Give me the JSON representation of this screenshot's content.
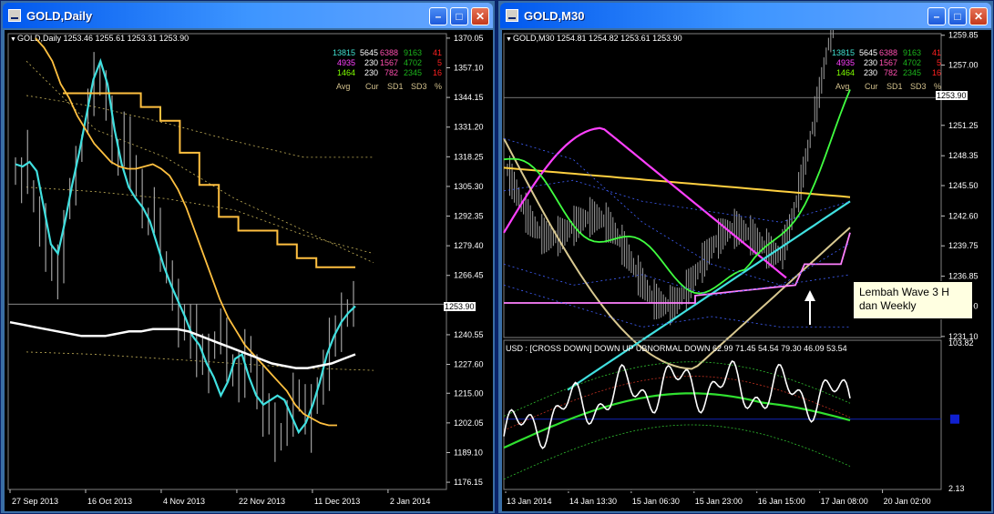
{
  "windows": [
    {
      "title": "GOLD,Daily",
      "header": "GOLD,Daily  1253.46 1255.61 1253.31 1253.90",
      "current_price_label": "1253.90"
    },
    {
      "title": "GOLD,M30",
      "header": "GOLD,M30  1254.81 1254.82 1253.61 1253.90",
      "current_price_label": "1253.90",
      "annotation": [
        "Lembah Wave 3 H",
        "dan Weekly"
      ],
      "indicator_header": "USD :  [CROSS DOWN]   DOWN    UP   UBNORMAL DOWN     62.99 71.45 54.54 79.30  46.09 53.54"
    }
  ],
  "stats_table": {
    "rows": [
      {
        "avg": "13815",
        "cur": "5645",
        "sd1": "6388",
        "sd3": "9163",
        "pct": "41",
        "avg_color": "#40e0d0",
        "sd1_color": "#ff4fb0",
        "sd3_color": "#1cb51c",
        "pct_color": "#ff2020"
      },
      {
        "avg": "4935",
        "cur": "230",
        "sd1": "1567",
        "sd3": "4702",
        "pct": "5",
        "avg_color": "#ff40ff",
        "sd1_color": "#ff4fb0",
        "sd3_color": "#1cb51c",
        "pct_color": "#ff2020"
      },
      {
        "avg": "1464",
        "cur": "230",
        "sd1": "782",
        "sd3": "2345",
        "pct": "16",
        "avg_color": "#7fff00",
        "sd1_color": "#ff4fb0",
        "sd3_color": "#1cb51c",
        "pct_color": "#ff2020"
      }
    ],
    "headers": [
      "Avg",
      "Cur",
      "SD1",
      "SD3",
      "%"
    ],
    "header_color": "#d2c08c",
    "cur_color": "#ffffff"
  },
  "chart_data": [
    {
      "type": "line",
      "name": "GOLD,Daily",
      "ohlc": {
        "open": 1253.46,
        "high": 1255.61,
        "low": 1253.31,
        "close": 1253.9
      },
      "x_ticks": [
        "27 Sep 2013",
        "16 Oct 2013",
        "4 Nov 2013",
        "22 Nov 2013",
        "11 Dec 2013",
        "2 Jan 2014"
      ],
      "y_ticks": [
        1370.05,
        1357.1,
        1344.15,
        1331.2,
        1318.25,
        1305.3,
        1292.35,
        1279.4,
        1266.45,
        1253.9,
        1240.55,
        1227.6,
        1215.0,
        1202.05,
        1189.1,
        1176.15
      ],
      "ylim": [
        1173,
        1372
      ],
      "series": [
        {
          "color": "#a0a0a0",
          "style": "bars",
          "values": [
            1312,
            1308,
            1316,
            1301,
            1290,
            1283,
            1272,
            1268,
            1279,
            1300,
            1310,
            1322,
            1338,
            1350,
            1352,
            1345,
            1330,
            1318,
            1326,
            1320,
            1310,
            1300,
            1290,
            1295,
            1282,
            1270,
            1262,
            1250,
            1246,
            1242,
            1238,
            1232,
            1228,
            1236,
            1242,
            1234,
            1225,
            1222,
            1228,
            1232,
            1220,
            1212,
            1206,
            1198,
            1196,
            1202,
            1210,
            1214,
            1208,
            1204,
            1214,
            1222,
            1232,
            1240,
            1246,
            1250,
            1254
          ]
        },
        {
          "color": "#40e0e0",
          "values": [
            1315,
            1314,
            1316,
            1312,
            1296,
            1280,
            1276,
            1290,
            1306,
            1320,
            1336,
            1352,
            1360,
            1350,
            1330,
            1315,
            1305,
            1300,
            1296,
            1290,
            1280,
            1270,
            1262,
            1255,
            1248,
            1240,
            1236,
            1228,
            1222,
            1214,
            1220,
            1230,
            1232,
            1222,
            1214,
            1210,
            1212,
            1214,
            1212,
            1205,
            1198,
            1202,
            1210,
            1220,
            1232,
            1240,
            1246,
            1250,
            1253
          ]
        },
        {
          "color": "#ffc040",
          "values": [
            1370,
            1366,
            1360,
            1350,
            1344,
            1336,
            1330,
            1324,
            1320,
            1316,
            1314,
            1313,
            1313,
            1314,
            1315,
            1313,
            1310,
            1304,
            1296,
            1286,
            1276,
            1266,
            1256,
            1248,
            1242,
            1236,
            1232,
            1228,
            1224,
            1220,
            1216,
            1210,
            1206,
            1204,
            1202,
            1201,
            1201
          ]
        },
        {
          "color": "#ffffff",
          "values": [
            1246,
            1245,
            1244,
            1243,
            1242,
            1241,
            1240,
            1240,
            1240,
            1241,
            1242,
            1242,
            1243,
            1243,
            1243,
            1242,
            1240,
            1238,
            1236,
            1234,
            1232,
            1230,
            1228,
            1227,
            1226,
            1226,
            1227,
            1228,
            1230,
            1232
          ]
        },
        {
          "color": "#ffc040",
          "style": "step",
          "values": [
            1346,
            1346,
            1346,
            1346,
            1340,
            1334,
            1320,
            1306,
            1292,
            1286,
            1286,
            1280,
            1274,
            1270,
            1270,
            1270
          ]
        }
      ]
    },
    {
      "type": "line",
      "name": "GOLD,M30",
      "ohlc": {
        "open": 1254.81,
        "high": 1254.82,
        "low": 1253.61,
        "close": 1253.9
      },
      "x_ticks": [
        "13 Jan 2014",
        "14 Jan 13:30",
        "15 Jan 06:30",
        "15 Jan 23:00",
        "16 Jan 15:00",
        "17 Jan 08:00",
        "20 Jan 02:00"
      ],
      "y_ticks": [
        1259.85,
        1257.0,
        1253.9,
        1251.25,
        1248.35,
        1245.5,
        1242.6,
        1239.75,
        1236.85,
        1234.0,
        1231.1
      ],
      "ylim": [
        1231,
        1260
      ],
      "indicator_ylim": [
        2.13,
        103.82
      ],
      "indicator_ticks": [
        103.82,
        2.13
      ]
    }
  ],
  "colors": {
    "window_title_gradient_start": "#0058ee",
    "chart_bg": "#000000",
    "grid_dotted": "#c8b45a"
  }
}
